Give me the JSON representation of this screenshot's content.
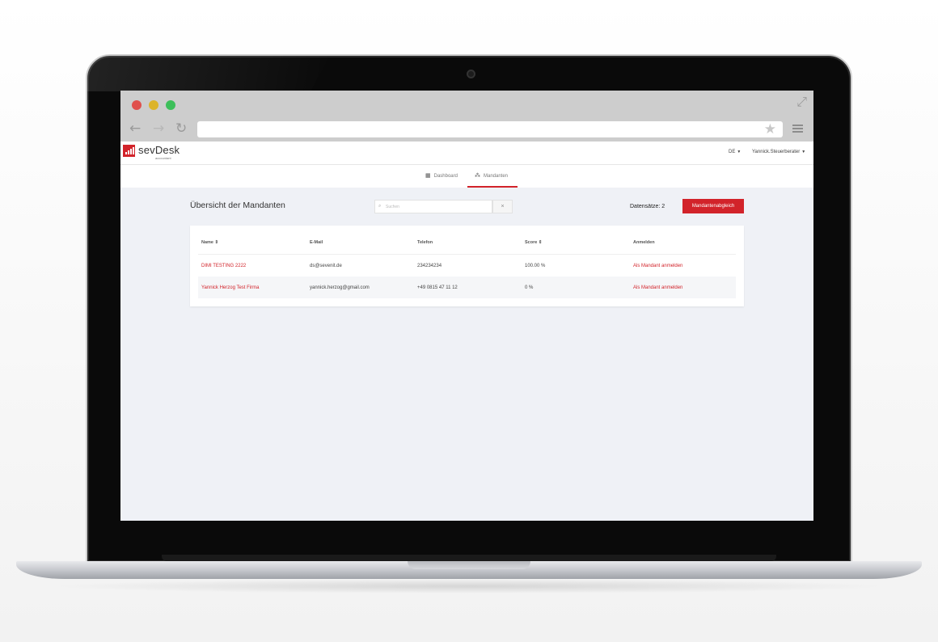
{
  "browser": {
    "url": ""
  },
  "header": {
    "logo_text": "sevDesk",
    "logo_subtext": "accountant",
    "language": "DE",
    "user": "Yannick.Steuerberater"
  },
  "tabs": [
    {
      "label": "Dashboard",
      "icon": "grid-icon"
    },
    {
      "label": "Mandanten",
      "icon": "sitemap-icon",
      "active": true
    }
  ],
  "main": {
    "title": "Übersicht der Mandanten",
    "search_placeholder": "Suchen",
    "clear_label": "×",
    "count_label": "Datensätze: 2",
    "sync_button": "Mandantenabgleich"
  },
  "table": {
    "columns": [
      "Name",
      "E-Mail",
      "Telefon",
      "Score",
      "Anmelden"
    ],
    "sortable": [
      "Name",
      "Score"
    ],
    "rows": [
      {
        "name": "DIMI TESTING 2222",
        "email": "ds@sevenit.de",
        "phone": "234234234",
        "score": "100.00 %",
        "action": "Als Mandant anmelden"
      },
      {
        "name": "Yannick Herzog Test Firma",
        "email": "yannick.herzog@gmail.com",
        "phone": "+49 0815 47 11 12",
        "score": "0 %",
        "action": "Als Mandant anmelden"
      }
    ]
  },
  "colors": {
    "accent": "#d2232a",
    "page_background": "#eff1f6"
  }
}
